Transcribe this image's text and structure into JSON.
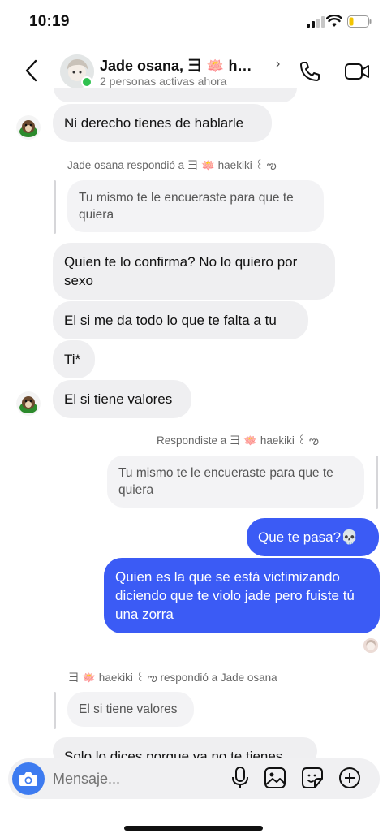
{
  "status_bar": {
    "time": "10:19"
  },
  "header": {
    "title": "Jade osana, ⺕ 🪷 h…",
    "subtitle": "2 personas activas ahora"
  },
  "messages": [
    {
      "text": "Ni derecho tienes de hablarle"
    },
    {
      "reply_meta": "Jade osana respondió a ⺕  🪷  haekiki  ꒰  ఌ",
      "quote": "Tu mismo te le encueraste para que te quiera"
    },
    {
      "text": "Quien te lo confirma? No lo quiero por sexo"
    },
    {
      "text": "El si me da todo lo que te falta a tu"
    },
    {
      "text": "Ti*"
    },
    {
      "text": "El si tiene valores"
    },
    {
      "reply_meta": "Respondiste a ⺕  🪷  haekiki  ꒰  ఌ",
      "quote": "Tu mismo te le encueraste para que te quiera"
    },
    {
      "text": "Que te pasa?💀"
    },
    {
      "text": "Quien es la que se está victimizando diciendo que te violo jade pero fuiste tú una zorra"
    },
    {
      "reply_meta": "⺕  🪷  haekiki  ꒰  ఌ respondió a Jade osana",
      "quote": "El si tiene valores"
    },
    {
      "text": "Solo lo dices porque ya no te tienes"
    }
  ],
  "composer": {
    "placeholder": "Mensaje..."
  },
  "icons": {
    "back": "chevron-left-icon",
    "call": "phone-icon",
    "video": "video-camera-icon",
    "camera": "camera-icon",
    "mic": "microphone-icon",
    "gallery": "image-icon",
    "sticker": "sticker-icon",
    "add": "plus-circle-icon"
  },
  "colors": {
    "outgoing": "#3b5bf5",
    "incoming": "#efeff1",
    "online": "#2fc14f",
    "camera": "#3d7bf0"
  }
}
